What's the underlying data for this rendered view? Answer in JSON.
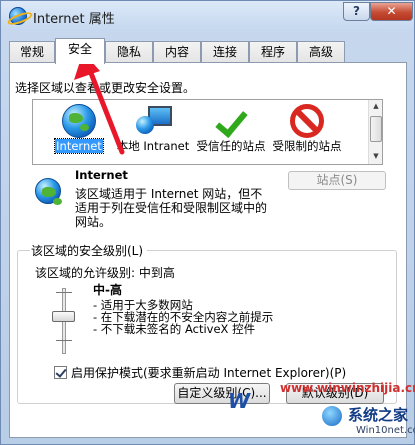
{
  "window": {
    "title": "Internet 属性",
    "help": "?",
    "close": "✕"
  },
  "tabs": [
    "常规",
    "安全",
    "隐私",
    "内容",
    "连接",
    "程序",
    "高级"
  ],
  "security": {
    "instruction": "选择区域以查看或更改安全设置。",
    "zones": [
      {
        "label": "Internet",
        "icon": "globe-icon",
        "selected": true
      },
      {
        "label": "本地 Intranet",
        "icon": "intranet-icon",
        "selected": false
      },
      {
        "label": "受信任的站点",
        "icon": "check-icon",
        "selected": false
      },
      {
        "label": "受限制的站点",
        "icon": "forbid-icon",
        "selected": false
      }
    ],
    "zone_detail": {
      "name": "Internet",
      "description": "该区域适用于 Internet 网站，但不适用于列在受信任和受限制区域中的网站。",
      "sites_button": "站点(S)"
    },
    "level_group_title": "该区域的安全级别(L)",
    "allowed_levels": "该区域的允许级别: 中到高",
    "level_name": "中-高",
    "level_bullets": [
      "- 适用于大多数网站",
      "- 在下载潜在的不安全内容之前提示",
      "- 不下载未签名的 ActiveX 控件"
    ],
    "protect_mode": "启用保护模式(要求重新启动 Internet Explorer)(P)",
    "custom_level_button": "自定义级别(C)...",
    "default_level_button": "默认级别(D)"
  },
  "watermark": {
    "url": "www.winwinzhijia.cn",
    "brand": "系统之家",
    "site": "Win10net.com",
    "partial": "W"
  },
  "colors": {
    "accent_arrow": "#e8182a",
    "selection": "#3399ff"
  }
}
